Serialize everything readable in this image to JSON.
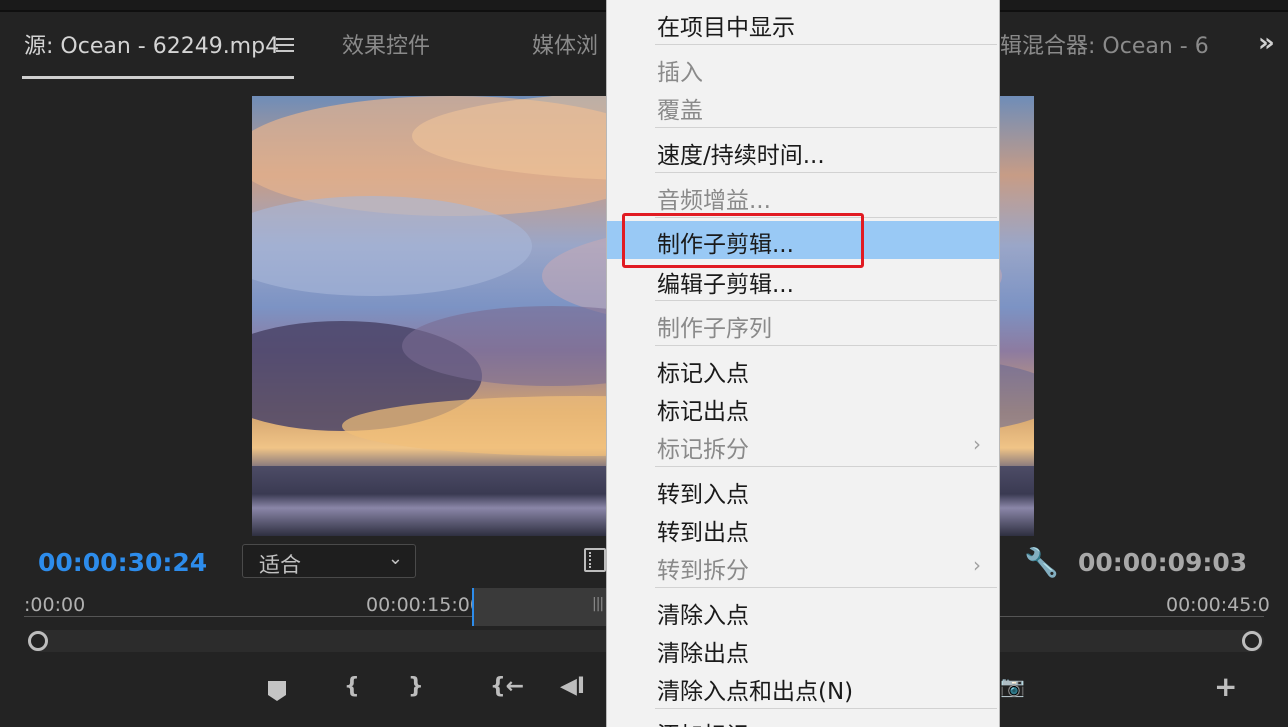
{
  "panel": {
    "tabs": [
      {
        "label": "源: Ocean - 62249.mp4"
      },
      {
        "label": "效果控件"
      },
      {
        "label": "媒体浏"
      },
      {
        "label": "辑混合器: Ocean - 6"
      }
    ],
    "more_label": "»"
  },
  "monitor": {
    "current_time": "00:00:30:24",
    "duration": "00:00:09:03",
    "zoom_value": "适合",
    "dropdown_chevron": "⌄",
    "ruler": [
      "00:00",
      "00:00:15:00",
      "00:00:45:0"
    ]
  },
  "transport": {
    "left_brace": "{",
    "right_brace": "}",
    "goto_in": "{←",
    "step_back": "◀I",
    "add": "+"
  },
  "context_menu": {
    "items": [
      {
        "label": "在项目中显示",
        "enabled": true
      },
      {
        "label": "插入",
        "enabled": false
      },
      {
        "label": "覆盖",
        "enabled": false
      },
      {
        "label": "速度/持续时间...",
        "enabled": true
      },
      {
        "label": "音频增益...",
        "enabled": false
      },
      {
        "label": "制作子剪辑...",
        "enabled": true,
        "highlighted": true
      },
      {
        "label": "编辑子剪辑...",
        "enabled": true
      },
      {
        "label": "制作子序列",
        "enabled": false
      },
      {
        "label": "标记入点",
        "enabled": true
      },
      {
        "label": "标记出点",
        "enabled": true
      },
      {
        "label": "标记拆分",
        "enabled": false,
        "submenu": true
      },
      {
        "label": "转到入点",
        "enabled": true
      },
      {
        "label": "转到出点",
        "enabled": true
      },
      {
        "label": "转到拆分",
        "enabled": false,
        "submenu": true
      },
      {
        "label": "清除入点",
        "enabled": true
      },
      {
        "label": "清除出点",
        "enabled": true
      },
      {
        "label": "清除入点和出点(N)",
        "enabled": true
      },
      {
        "label": "添加标记",
        "enabled": true
      }
    ],
    "submenu_glyph": "›"
  },
  "colors": {
    "timecode_blue": "#2d8ceb",
    "highlight": "#99c9f5",
    "annotation_red": "#e11b22"
  }
}
